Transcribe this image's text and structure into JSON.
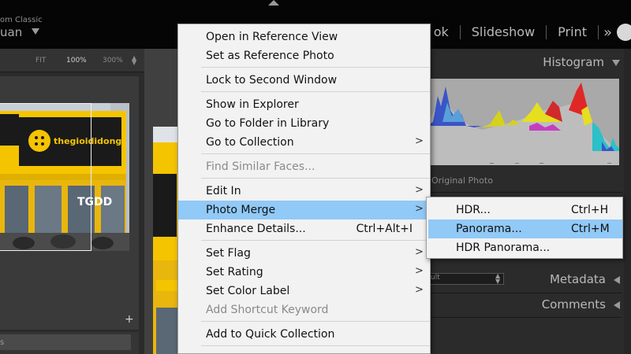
{
  "topbar": {
    "brand_small": "om Classic",
    "brand_name": "uan",
    "modules": [
      "ok",
      "Slideshow",
      "Print"
    ],
    "more_label": "»"
  },
  "navigator": {
    "zoom_levels": [
      "FIT",
      "100%",
      "300%"
    ],
    "active_zoom": "100%",
    "overlay_text": "TGDD",
    "sign_text": "thegioididong"
  },
  "left_panel": {
    "add_label": "+",
    "input_text": "s"
  },
  "right_panel": {
    "histogram_title": "Histogram",
    "original_photo_label": "Original Photo",
    "metadata_title": "Metadata",
    "comments_title": "Comments",
    "metadata_preset": "ult"
  },
  "context_menu": {
    "items": [
      {
        "label": "Open in Reference View",
        "shortcut": "",
        "submenu": false,
        "disabled": false
      },
      {
        "label": "Set as Reference Photo",
        "shortcut": "",
        "submenu": false,
        "disabled": false
      },
      {
        "label": "Lock to Second Window",
        "shortcut": "",
        "submenu": false,
        "disabled": false
      },
      {
        "label": "Show in Explorer",
        "shortcut": "",
        "submenu": false,
        "disabled": false
      },
      {
        "label": "Go to Folder in Library",
        "shortcut": "",
        "submenu": false,
        "disabled": false
      },
      {
        "label": "Go to Collection",
        "shortcut": "",
        "submenu": true,
        "disabled": false
      },
      {
        "label": "Find Similar Faces...",
        "shortcut": "",
        "submenu": false,
        "disabled": true
      },
      {
        "label": "Edit In",
        "shortcut": "",
        "submenu": true,
        "disabled": false
      },
      {
        "label": "Photo Merge",
        "shortcut": "",
        "submenu": true,
        "disabled": false
      },
      {
        "label": "Enhance Details...",
        "shortcut": "Ctrl+Alt+I",
        "submenu": false,
        "disabled": false
      },
      {
        "label": "Set Flag",
        "shortcut": "",
        "submenu": true,
        "disabled": false
      },
      {
        "label": "Set Rating",
        "shortcut": "",
        "submenu": true,
        "disabled": false
      },
      {
        "label": "Set Color Label",
        "shortcut": "",
        "submenu": true,
        "disabled": false
      },
      {
        "label": "Add Shortcut Keyword",
        "shortcut": "",
        "submenu": false,
        "disabled": true
      },
      {
        "label": "Add to Quick Collection",
        "shortcut": "",
        "submenu": false,
        "disabled": false
      }
    ],
    "highlighted": "Photo Merge",
    "arrow_glyph": ">"
  },
  "photo_merge_submenu": {
    "items": [
      {
        "label": "HDR...",
        "shortcut": "Ctrl+H"
      },
      {
        "label": "Panorama...",
        "shortcut": "Ctrl+M"
      },
      {
        "label": "HDR Panorama...",
        "shortcut": ""
      }
    ],
    "highlighted": "Panorama..."
  },
  "colors": {
    "menu_bg": "#f2f2f2",
    "menu_highlight": "#91c9f7",
    "panel_bg": "#2b2b2b",
    "topbar_bg": "#050505",
    "store_yellow": "#f5c400"
  }
}
